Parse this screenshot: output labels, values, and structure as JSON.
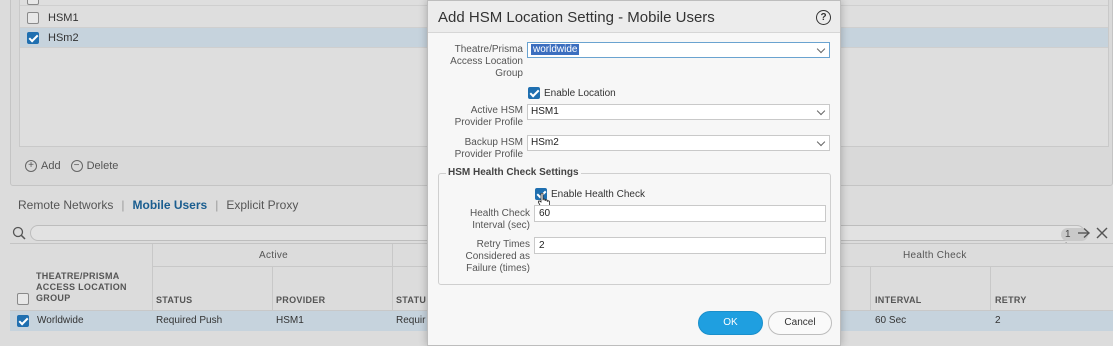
{
  "top_list": {
    "rows": [
      {
        "name": "HSM1",
        "checked": false
      },
      {
        "name": "HSm2",
        "checked": true
      }
    ],
    "add_label": "Add",
    "delete_label": "Delete"
  },
  "tabs": {
    "items": [
      "Remote Networks",
      "Mobile Users",
      "Explicit Proxy"
    ],
    "active": "Mobile Users"
  },
  "search": {
    "count_label": "1 item"
  },
  "table": {
    "group_headers": {
      "active": "Active",
      "health_check": "Health Check"
    },
    "columns": {
      "theatre": "THEATRE/PRISMA ACCESS LOCATION GROUP",
      "status": "STATUS",
      "provider": "PROVIDER",
      "status2": "STATU",
      "interval": "INTERVAL",
      "retry": "RETRY"
    },
    "row": {
      "theatre": "Worldwide",
      "status": "Required Push",
      "provider": "HSM1",
      "status2": "Requir",
      "interval": "60 Sec",
      "retry": "2"
    }
  },
  "dialog": {
    "title": "Add HSM Location Setting - Mobile Users",
    "help_glyph": "?",
    "location_group_label": "Theatre/Prisma Access Location Group",
    "location_group_value": "worldwide",
    "enable_location_label": "Enable Location",
    "active_profile_label": "Active HSM Provider Profile",
    "active_profile_value": "HSM1",
    "backup_profile_label": "Backup HSM Provider Profile",
    "backup_profile_value": "HSm2",
    "health_section_title": "HSM Health Check Settings",
    "enable_health_label": "Enable Health Check",
    "interval_label": "Health Check Interval (sec)",
    "interval_value": "60",
    "retry_label": "Retry Times Considered as Failure (times)",
    "retry_value": "2",
    "ok_label": "OK",
    "cancel_label": "Cancel"
  },
  "colors": {
    "accent": "#1f9fe0",
    "checkbox": "#1f6fb0",
    "selected_row": "#c6d3dd",
    "active_tab": "#1a5d8f"
  }
}
